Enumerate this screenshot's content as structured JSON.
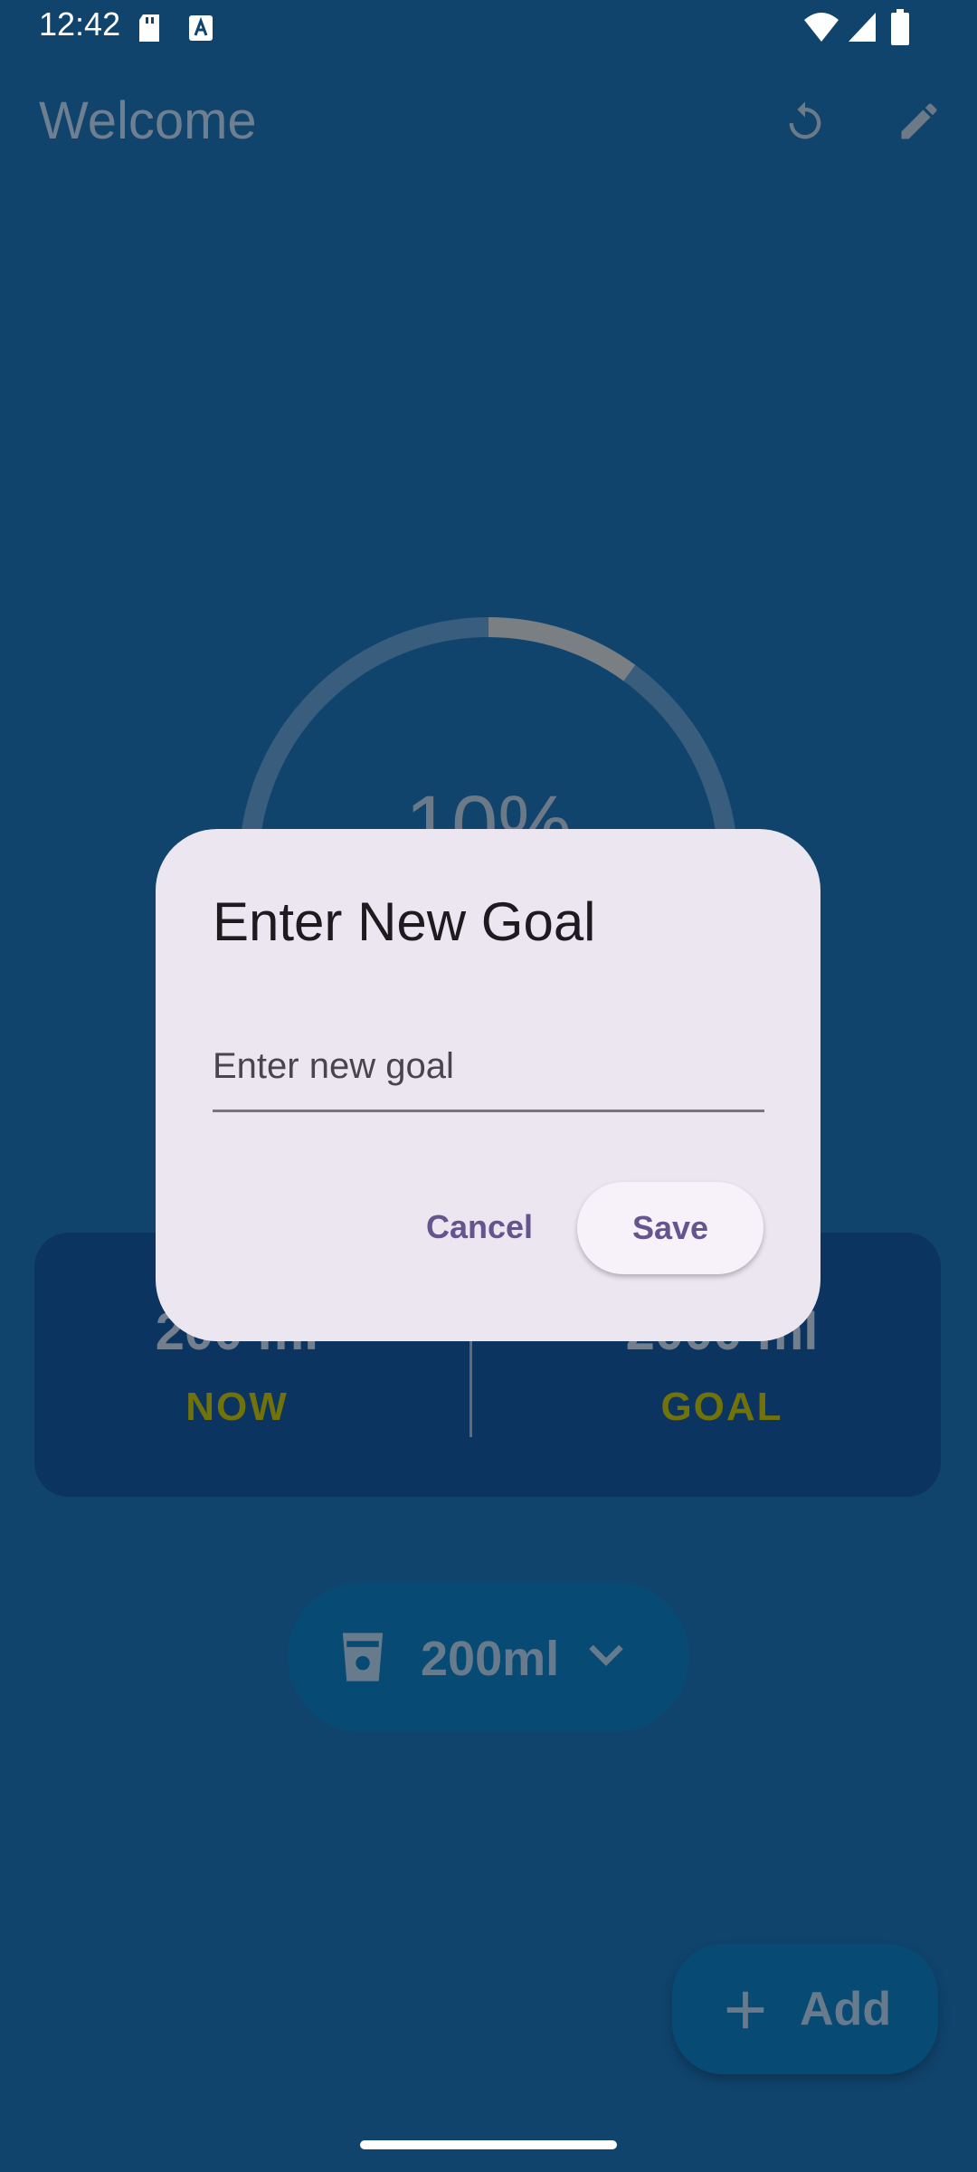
{
  "status_bar": {
    "time": "12:42"
  },
  "app_bar": {
    "title": "Welcome",
    "icons": [
      "refresh-icon",
      "edit-icon"
    ]
  },
  "progress": {
    "percent_text": "10%",
    "fraction": 0.1
  },
  "stats": {
    "now": {
      "value": "200 ml",
      "label": "NOW"
    },
    "goal": {
      "value": "2000 ml",
      "label": "GOAL"
    }
  },
  "cup_selector": {
    "label": "200ml",
    "icon": "cup-icon"
  },
  "fab": {
    "label": "Add",
    "icon": "plus-icon"
  },
  "dialog": {
    "title": "Enter New Goal",
    "input_placeholder": "Enter new goal",
    "input_value": "",
    "cancel_label": "Cancel",
    "save_label": "Save"
  },
  "colors": {
    "background": "#10446d",
    "dialog": "#ece6f0",
    "accent": "#65558f",
    "label_olive": "#717209",
    "card": "#0b3560",
    "button_fill": "#074b74"
  }
}
